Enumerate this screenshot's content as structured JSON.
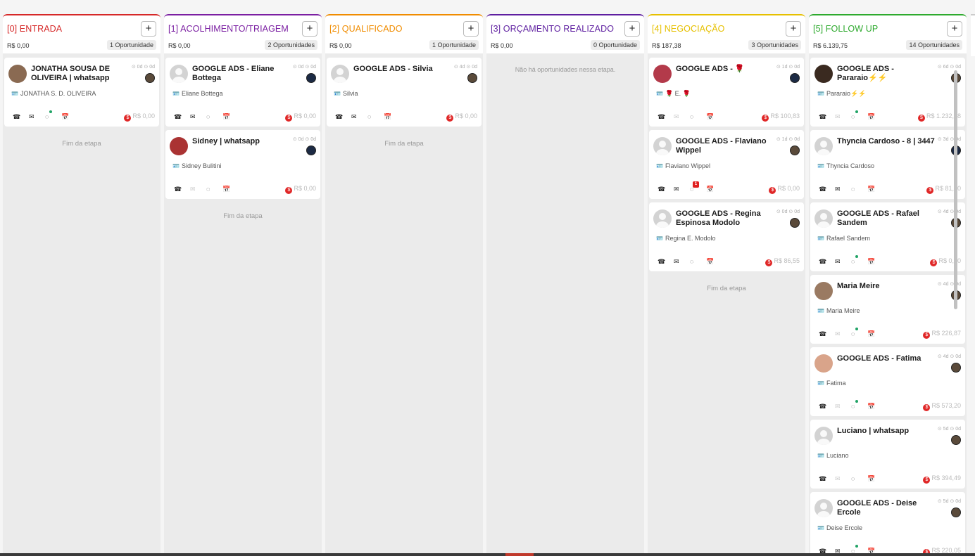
{
  "empty_message": "Não há oportunidades nessa etapa.",
  "end_label": "Fim da etapa",
  "icons": {
    "add": "+",
    "phone": "☎",
    "mail": "✉",
    "chat": "💬",
    "calendar": "📅",
    "contact": "🪪",
    "coin": "$"
  },
  "colors": {
    "entrada": "#d62828",
    "acolhimento": "#7b1fa2",
    "qualificado": "#f08c00",
    "orcamento": "#5e1fa0",
    "negociacao": "#e6c000",
    "followup": "#2eaa2e"
  },
  "columns": [
    {
      "title": "[0] ENTRADA",
      "total": "R$ 0,00",
      "count": "1 Oportunidade",
      "end": "Fim da etapa",
      "cards": [
        {
          "title": "JONATHA SOUSA DE OLIVEIRA  |  whatsapp",
          "times": "⊙ 0d ⊙ 0d",
          "contact": "JONATHA S. D. OLIVEIRA",
          "value": "R$ 0,00"
        }
      ]
    },
    {
      "title": "[1]  ACOLHIMENTO/TRIAGEM",
      "total": "R$ 0,00",
      "count": "2 Oportunidades",
      "end": "Fim da etapa",
      "cards": [
        {
          "title": "GOOGLE ADS - Eliane Bottega",
          "times": "⊙ 0d ⊙ 0d",
          "contact": "Eliane Bottega",
          "value": "R$ 0,00"
        },
        {
          "title": "Sidney  |  whatsapp",
          "times": "⊙ 0d ⊙ 0d",
          "contact": "Sidney Bulitini",
          "value": "R$ 0,00"
        }
      ]
    },
    {
      "title": "[2] QUALIFICADO",
      "total": "R$ 0,00",
      "count": "1 Oportunidade",
      "end": "Fim da etapa",
      "cards": [
        {
          "title": "GOOGLE ADS - Silvia",
          "times": "⊙ 4d ⊙ 0d",
          "contact": "Silvia",
          "value": "R$ 0,00"
        }
      ]
    },
    {
      "title": "[3] ORÇAMENTO REALIZADO",
      "total": "R$ 0,00",
      "count": "0 Oportunidade",
      "empty": "Não há oportunidades nessa etapa.",
      "cards": []
    },
    {
      "title": "[4] NEGOCIAÇÃO",
      "total": "R$ 187,38",
      "count": "3 Oportunidades",
      "end": "Fim da etapa",
      "cards": [
        {
          "title": "GOOGLE ADS - 🌹",
          "times": "⊙ 1d ⊙ 0d",
          "contact": "🌹 E. 🌹",
          "value": "R$ 100,83"
        },
        {
          "title": "GOOGLE ADS - Flaviano Wippel",
          "times": "⊙ 1d ⊙ 0d",
          "contact": "Flaviano Wippel",
          "value": "R$ 0,00",
          "badge": "1"
        },
        {
          "title": "GOOGLE ADS - Regina Espinosa Modolo",
          "times": "⊙ 0d ⊙ 0d",
          "contact": "Regina E. Modolo",
          "value": "R$ 86,55"
        }
      ]
    },
    {
      "title": "[5] FOLLOW UP",
      "total": "R$ 6.139,75",
      "count": "14 Oportunidades",
      "cards": [
        {
          "title": "GOOGLE ADS - Pararaio⚡⚡",
          "times": "⊙ 6d ⊙ 0d",
          "contact": "Pararaio⚡⚡",
          "value": "R$ 1.232,18"
        },
        {
          "title": "Thyncia Cardoso - 8 | 3447",
          "times": "⊙ 3d ⊙ 0d",
          "contact": "Thyncia Cardoso",
          "value": "R$ 81,00"
        },
        {
          "title": "GOOGLE ADS - Rafael Sandem",
          "times": "⊙ 4d ⊙ 0d",
          "contact": "Rafael Sandem",
          "value": "R$ 0,00"
        },
        {
          "title": "Maria Meire",
          "times": "⊙ 4d ⊙ 0d",
          "contact": "Maria Meire",
          "value": "R$ 226,87"
        },
        {
          "title": "GOOGLE ADS - Fatima",
          "times": "⊙ 4d ⊙ 0d",
          "contact": "Fatima",
          "value": "R$ 573,20"
        },
        {
          "title": "Luciano  |  whatsapp",
          "times": "⊙ 5d ⊙ 0d",
          "contact": "Luciano",
          "value": "R$ 394,49"
        },
        {
          "title": "GOOGLE ADS - Deise Ercole",
          "times": "⊙ 5d ⊙ 0d",
          "contact": "Deise Ercole",
          "value": "R$ 220,05"
        }
      ]
    }
  ]
}
